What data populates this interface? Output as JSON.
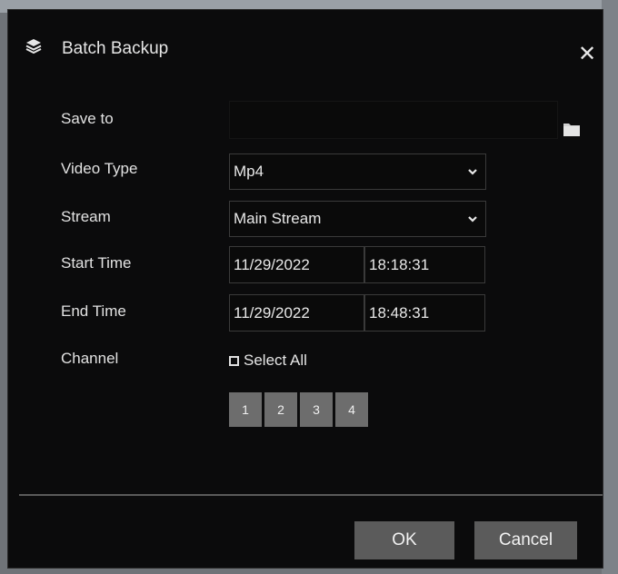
{
  "dialog": {
    "title": "Batch Backup",
    "close_symbol": "✕"
  },
  "form": {
    "save_to_label": "Save to",
    "save_to_value": "",
    "video_type_label": "Video Type",
    "video_type_value": "Mp4",
    "stream_label": "Stream",
    "stream_value": "Main Stream",
    "start_time_label": "Start Time",
    "start_date": "11/29/2022",
    "start_time": "18:18:31",
    "end_time_label": "End Time",
    "end_date": "11/29/2022",
    "end_time": "18:48:31",
    "channel_label": "Channel",
    "select_all_label": "Select All",
    "channels": [
      "1",
      "2",
      "3",
      "4"
    ]
  },
  "buttons": {
    "ok": "OK",
    "cancel": "Cancel"
  },
  "colors": {
    "dialog_bg": "#0b0b0c",
    "button_bg": "#5b5b5b",
    "channel_bg": "#6d6d6d"
  },
  "icons": {
    "title": "layers-icon",
    "close": "close-icon",
    "folder": "folder-icon",
    "dropdown": "chevron-down-icon"
  }
}
